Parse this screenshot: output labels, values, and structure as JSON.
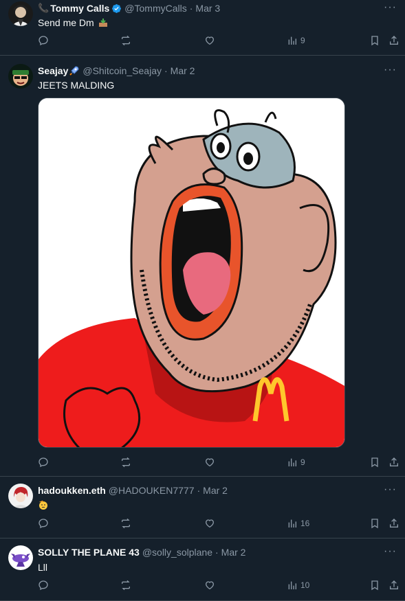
{
  "tweets": [
    {
      "name": "Tommy Calls",
      "name_prefix_icon": "phone-icon",
      "verified": true,
      "handle": "@TommyCalls",
      "date": "Mar 3",
      "text": "Send me Dm",
      "text_emoji": "inbox-tray-icon",
      "views": "9"
    },
    {
      "name": "Seajay",
      "name_suffix_icon": "rocket-icon",
      "handle": "@Shitcoin_Seajay",
      "date": "Mar 2",
      "text": "JEETS MALDING",
      "media": "cartoon-screaming-face-mcdonalds-shirt",
      "views": "9"
    },
    {
      "name": "hadoukken.eth",
      "handle": "@HADOUKEN7777",
      "date": "Mar 2",
      "text_emoji": "saluting-face-icon",
      "views": "16"
    },
    {
      "name": "SOLLY THE PLANE 43",
      "handle": "@solly_solplane",
      "date": "Mar 2",
      "text": "Lll",
      "views": "10"
    }
  ],
  "separator": "·",
  "more_label": "···",
  "colors": {
    "background": "#15202b",
    "muted": "#8b98a5",
    "verified": "#1d9bf0",
    "border": "#38444d"
  }
}
